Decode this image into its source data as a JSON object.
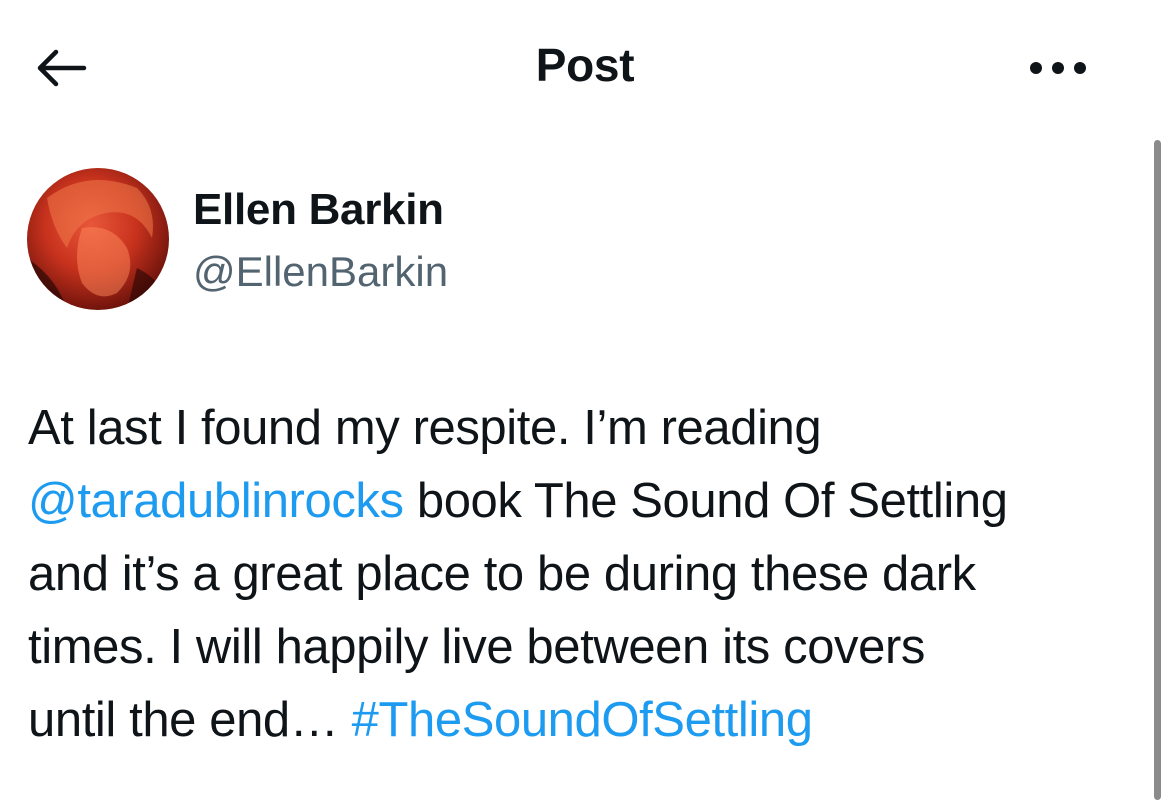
{
  "header": {
    "title": "Post",
    "back_icon": "arrow-left-icon",
    "more_icon": "more-horizontal-icon"
  },
  "author": {
    "display_name": "Ellen Barkin",
    "handle": "@EllenBarkin"
  },
  "post": {
    "line1": "At last I found my respite. I’m reading",
    "mention": "@taradublinrocks",
    "text_after_mention": " book The Sound Of Settling",
    "line3": "and it’s a great place to be during these dark",
    "line4": "times. I will happily live between its covers",
    "line5_text": "until the end… ",
    "hashtag": "#TheSoundOfSettling"
  },
  "colors": {
    "link": "#1d9bf0",
    "secondary_text": "#536471",
    "primary_text": "#0f1419"
  }
}
